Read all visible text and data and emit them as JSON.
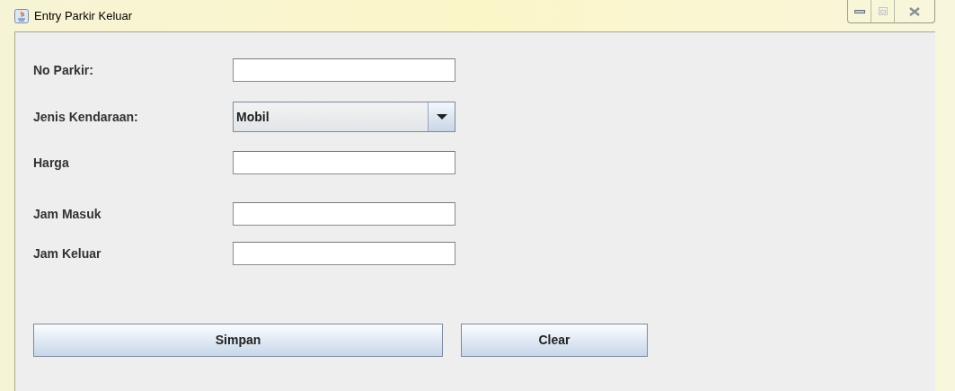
{
  "window": {
    "title": "Entry Parkir Keluar"
  },
  "fields": [
    {
      "kind": "text",
      "label": "No Parkir:"
    },
    {
      "kind": "combo",
      "label": "Jenis Kendaraan:",
      "value": "Mobil"
    },
    {
      "kind": "text",
      "label": "Harga"
    },
    {
      "kind": "text",
      "label": "Jam Masuk"
    },
    {
      "kind": "text",
      "label": "Jam Keluar"
    }
  ],
  "buttons": [
    "Simpan",
    "Clear"
  ]
}
